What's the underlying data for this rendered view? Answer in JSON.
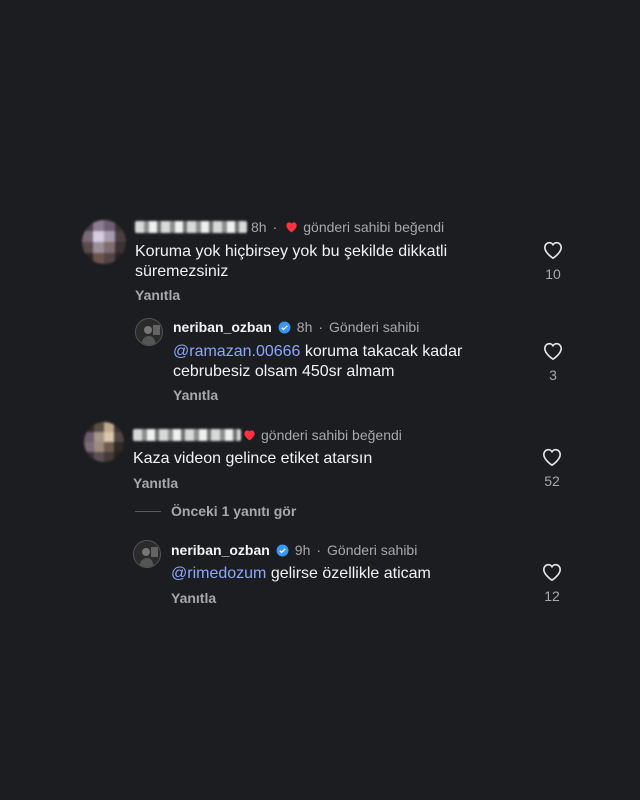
{
  "comments": [
    {
      "time": "8h",
      "liked_by_author": "gönderi sahibi beğendi",
      "text": "Koruma yok hiçbirsey yok bu şekilde dikkatli süremezsiniz",
      "reply_label": "Yanıtla",
      "likes": "10"
    },
    {
      "username": "neriban_ozban",
      "time": "8h",
      "author_label": "Gönderi sahibi",
      "mention": "@ramazan.00666",
      "text": " koruma takacak kadar cebrubesiz olsam 450sr almam",
      "reply_label": "Yanıtla",
      "likes": "3"
    },
    {
      "liked_by_author": "gönderi sahibi beğendi",
      "text": "Kaza videon gelince etiket atarsın",
      "reply_label": "Yanıtla",
      "likes": "52"
    },
    {
      "username": "neriban_ozban",
      "time": "9h",
      "author_label": "Gönderi sahibi",
      "mention": "@rimedozum",
      "text": " gelirse özellikle aticam",
      "reply_label": "Yanıtla",
      "likes": "12"
    }
  ],
  "view_previous": "Önceki 1 yanıtı gör",
  "colors": {
    "background": "#1b1d20",
    "heart_red": "#ff3040",
    "verified_blue": "#3897f0",
    "mention_blue": "#8ca7ff"
  },
  "icons": [
    "heart-outline-icon",
    "heart-filled-icon",
    "verified-badge-icon"
  ]
}
